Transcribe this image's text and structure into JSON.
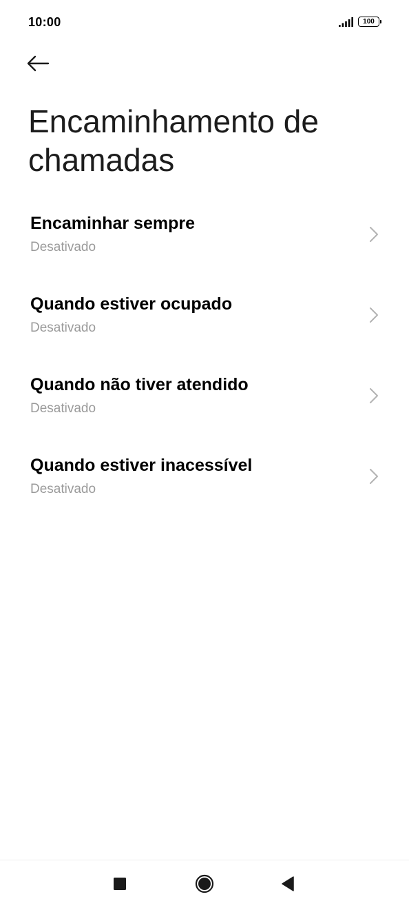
{
  "status_bar": {
    "time": "10:00",
    "battery_level": "100",
    "icons": [
      "signal-icon",
      "battery-icon"
    ]
  },
  "header": {
    "back_icon": "arrow-left-icon",
    "title": "Encaminhamento de chamadas"
  },
  "settings": [
    {
      "title": "Encaminhar sempre",
      "subtitle": "Desativado",
      "icon": "chevron-right-icon"
    },
    {
      "title": "Quando estiver ocupado",
      "subtitle": "Desativado",
      "icon": "chevron-right-icon"
    },
    {
      "title": "Quando não tiver atendido",
      "subtitle": "Desativado",
      "icon": "chevron-right-icon"
    },
    {
      "title": "Quando estiver inacessível",
      "subtitle": "Desativado",
      "icon": "chevron-right-icon"
    }
  ],
  "nav_bar": {
    "icons": [
      "recents-square-icon",
      "home-circle-icon",
      "back-triangle-icon"
    ]
  },
  "colors": {
    "background": "#ffffff",
    "title_text": "#1c1c1c",
    "item_title": "#000000",
    "item_subtitle": "#9a9a9a",
    "chevron": "#b3b3b3",
    "nav_icons": "#1a1a1a"
  }
}
